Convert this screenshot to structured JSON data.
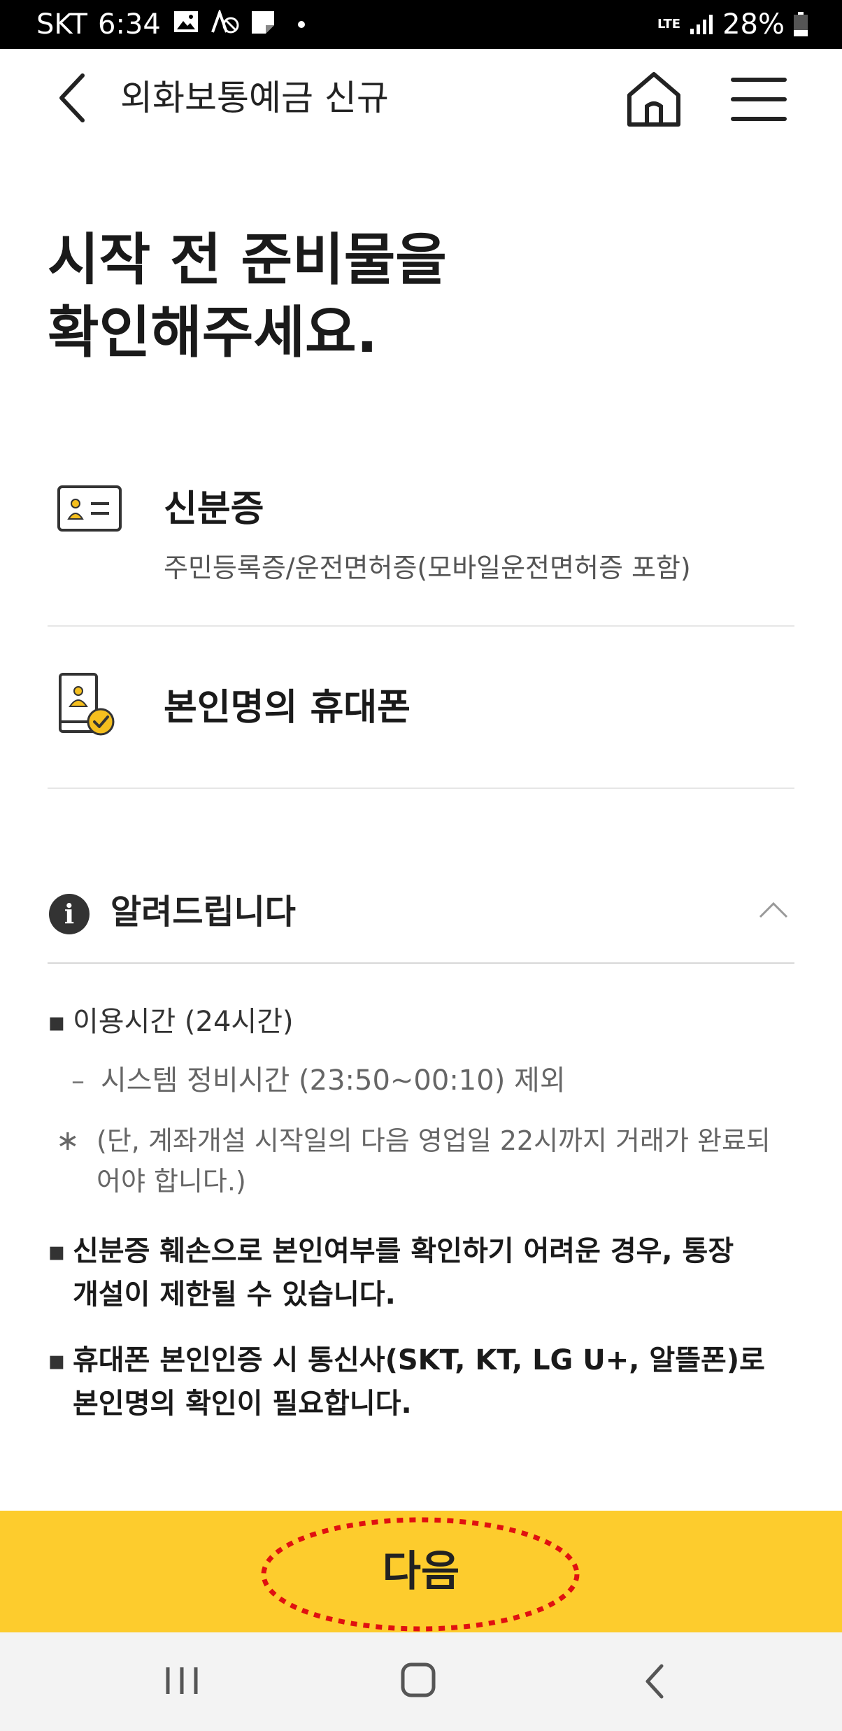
{
  "status_bar": {
    "carrier": "SKT",
    "time": "6:34",
    "network": "LTE",
    "battery": "28%"
  },
  "app_bar": {
    "title": "외화보통예금 신규",
    "icons": [
      "back-icon",
      "home-icon",
      "menu-icon"
    ]
  },
  "heading": {
    "line1": "시작 전 준비물을",
    "line2": "확인해주세요."
  },
  "items": [
    {
      "icon": "id-card-icon",
      "title": "신분증",
      "desc": "주민등록증/운전면허증(모바일운전면허증 포함)"
    },
    {
      "icon": "phone-verified-icon",
      "title": "본인명의 휴대폰"
    }
  ],
  "notice": {
    "title": "알려드립니다",
    "lines": {
      "usage_time": "이용시간 (24시간)",
      "maintenance": "시스템 정비시간 (23:50~00:10) 제외",
      "note_line1": "(단, 계좌개설 시작일의 다음 영업일 22시까지 거래가 완료되",
      "note_line2": "어야 합니다.)",
      "id_damage_line1": "신분증 훼손으로 본인여부를 확인하기 어려운 경우, 통장",
      "id_damage_line2": "개설이 제한될 수 있습니다.",
      "phone_auth_line1": "휴대폰 본인인증 시 통신사(SKT, KT, LG U+, 알뜰폰)로",
      "phone_auth_line2": "본인명의 확인이 필요합니다."
    },
    "bullet_symbol": "▪",
    "dash_symbol": "–",
    "asterisk_symbol": "∗"
  },
  "next_button": {
    "label": "다음"
  },
  "colors": {
    "accent_yellow": "#fdcc2d",
    "icon_yellow": "#f5bf1e",
    "highlight_red": "#e01010"
  }
}
